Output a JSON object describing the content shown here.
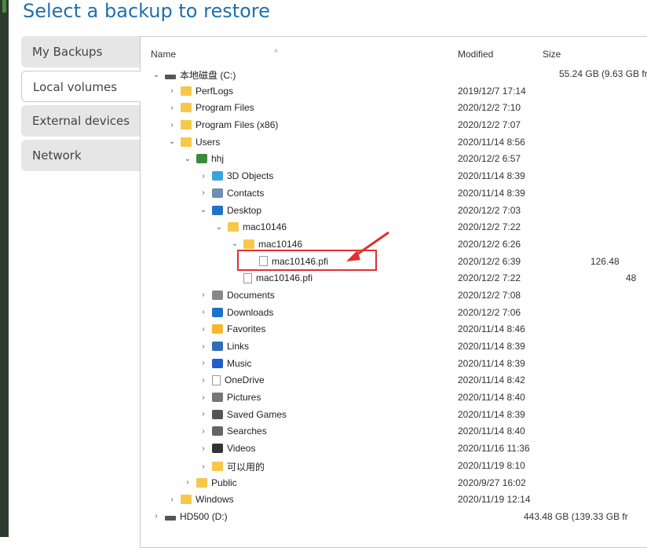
{
  "page": {
    "title": "Select a backup to restore"
  },
  "tabs": [
    {
      "label": "My Backups",
      "active": false
    },
    {
      "label": "Local volumes",
      "active": true
    },
    {
      "label": "External devices",
      "active": false
    },
    {
      "label": "Network",
      "active": false
    }
  ],
  "columns": {
    "name": "Name",
    "modified": "Modified",
    "size": "Size"
  },
  "rows": [
    {
      "name": "本地磁盘 (C:)",
      "modified": "",
      "size": "55.24 GB (9.63 GB fr",
      "icon": "drive-icon",
      "expanded": true
    },
    {
      "name": "PerfLogs",
      "modified": "2019/12/7 17:14",
      "size": "",
      "icon": "folder-icon",
      "expanded": false
    },
    {
      "name": "Program Files",
      "modified": "2020/12/2 7:10",
      "size": "",
      "icon": "folder-icon",
      "expanded": false
    },
    {
      "name": "Program Files (x86)",
      "modified": "2020/12/2 7:07",
      "size": "",
      "icon": "folder-icon",
      "expanded": false
    },
    {
      "name": "Users",
      "modified": "2020/11/14 8:56",
      "size": "",
      "icon": "folder-icon",
      "expanded": true
    },
    {
      "name": "hhj",
      "modified": "2020/12/2 6:57",
      "size": "",
      "icon": "user-icon",
      "expanded": true
    },
    {
      "name": "3D Objects",
      "modified": "2020/11/14 8:39",
      "size": "",
      "icon": "cube-icon",
      "expanded": false
    },
    {
      "name": "Contacts",
      "modified": "2020/11/14 8:39",
      "size": "",
      "icon": "contacts-icon",
      "expanded": false
    },
    {
      "name": "Desktop",
      "modified": "2020/12/2 7:03",
      "size": "",
      "icon": "desktop-icon",
      "expanded": true
    },
    {
      "name": "mac10146",
      "modified": "2020/12/2 7:22",
      "size": "",
      "icon": "folder-icon",
      "expanded": true
    },
    {
      "name": "mac10146",
      "modified": "2020/12/2 6:26",
      "size": "",
      "icon": "folder-icon",
      "expanded": true
    },
    {
      "name": "mac10146.pfi",
      "modified": "2020/12/2 6:39",
      "size": "126.48",
      "icon": "file-icon",
      "expanded": null,
      "highlighted": true
    },
    {
      "name": "mac10146.pfi",
      "modified": "2020/12/2 7:22",
      "size": "48",
      "icon": "file-icon",
      "expanded": null
    },
    {
      "name": "Documents",
      "modified": "2020/12/2 7:08",
      "size": "",
      "icon": "documents-icon",
      "expanded": false
    },
    {
      "name": "Downloads",
      "modified": "2020/12/2 7:06",
      "size": "",
      "icon": "download-icon",
      "expanded": false
    },
    {
      "name": "Favorites",
      "modified": "2020/11/14 8:46",
      "size": "",
      "icon": "star-icon",
      "expanded": false
    },
    {
      "name": "Links",
      "modified": "2020/11/14 8:39",
      "size": "",
      "icon": "link-icon",
      "expanded": false
    },
    {
      "name": "Music",
      "modified": "2020/11/14 8:39",
      "size": "",
      "icon": "music-icon",
      "expanded": false
    },
    {
      "name": "OneDrive",
      "modified": "2020/11/14 8:42",
      "size": "",
      "icon": "file-icon",
      "expanded": false
    },
    {
      "name": "Pictures",
      "modified": "2020/11/14 8:40",
      "size": "",
      "icon": "pictures-icon",
      "expanded": false
    },
    {
      "name": "Saved Games",
      "modified": "2020/11/14 8:39",
      "size": "",
      "icon": "games-icon",
      "expanded": false
    },
    {
      "name": "Searches",
      "modified": "2020/11/14 8:40",
      "size": "",
      "icon": "search-icon",
      "expanded": false
    },
    {
      "name": "Videos",
      "modified": "2020/11/16 11:36",
      "size": "",
      "icon": "video-icon",
      "expanded": false
    },
    {
      "name": "可以用的",
      "modified": "2020/11/19 8:10",
      "size": "",
      "icon": "folder-icon",
      "expanded": false
    },
    {
      "name": "Public",
      "modified": "2020/9/27 16:02",
      "size": "",
      "icon": "folder-icon",
      "expanded": false
    },
    {
      "name": "Windows",
      "modified": "2020/11/19 12:14",
      "size": "",
      "icon": "folder-icon",
      "expanded": false
    },
    {
      "name": "HD500 (D:)",
      "modified": "",
      "size": "443.48 GB (139.33 GB fr",
      "icon": "drive-icon",
      "expanded": false
    }
  ],
  "colors": {
    "accent": "#1f6fb0",
    "highlight": "#e03030",
    "folder": "#f5c84a"
  }
}
